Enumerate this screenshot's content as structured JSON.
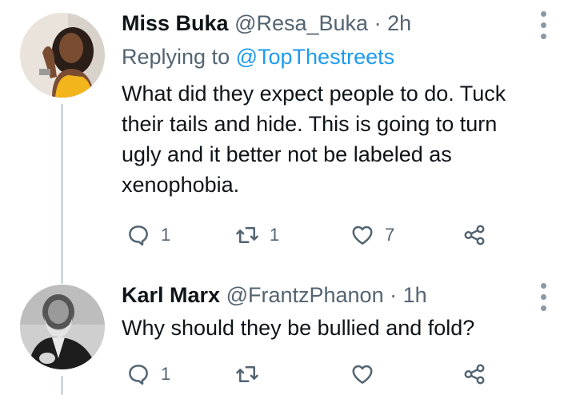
{
  "tweets": [
    {
      "name": "Miss Buka",
      "handle": "@Resa_Buka",
      "separator": "·",
      "time": "2h",
      "replying_prefix": "Replying to",
      "replying_to": "@TopThestreets",
      "text_lines": [
        "What did they expect people to do. Tuck",
        "their tails and hide. This is going to turn",
        "ugly and it better not be labeled as",
        "xenophobia."
      ],
      "replies": "1",
      "retweets": "1",
      "likes": "7"
    },
    {
      "name": "Karl Marx",
      "handle": "@FrantzPhanon",
      "separator": "·",
      "time": "1h",
      "text_lines": [
        "Why should they be bullied and fold?"
      ],
      "replies": "1",
      "retweets": "",
      "likes": ""
    }
  ],
  "colors": {
    "text": "#0f1419",
    "secondary": "#536471",
    "link": "#1d9bf0",
    "thread_line": "#cfd9de"
  },
  "icons": {
    "reply": "speech-bubble-icon",
    "retweet": "retweet-arrows-icon",
    "like": "heart-icon",
    "share": "share-icon",
    "more": "vertical-dots-icon"
  }
}
